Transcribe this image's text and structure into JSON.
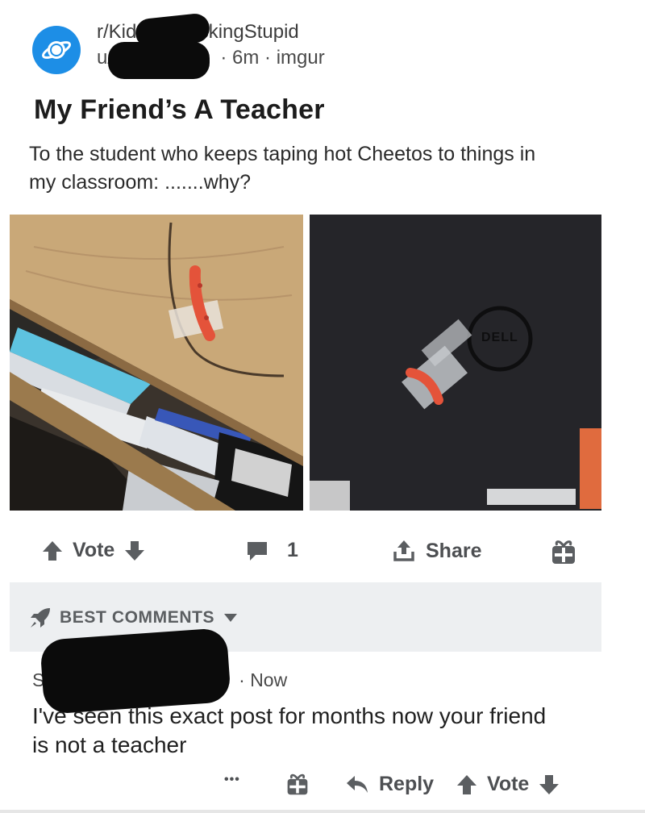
{
  "post": {
    "subreddit": "r/KidsAreFuckingStupid",
    "user_prefix": "u/",
    "age": "6m",
    "source": "imgur",
    "separator": "·",
    "title": "My Friend’s A Teacher",
    "body": "To the student who keeps taping hot Cheetos to things in my classroom: .......why?",
    "laptop_brand": "DELL"
  },
  "actions": {
    "vote_label": "Vote",
    "comment_count": "1",
    "share_label": "Share"
  },
  "comments_header": {
    "sort_label": "BEST COMMENTS"
  },
  "comment": {
    "author_initial": "S",
    "age": "Now",
    "text": "I've seen this exact post for months now your friend is not a teacher",
    "more_label": "•••",
    "reply_label": "Reply",
    "vote_label": "Vote"
  },
  "colors": {
    "subreddit_icon": "#1d8ee6",
    "best_band": "#edeff1",
    "icon_gray": "#5b5e61",
    "cheeto": "#e4533a"
  }
}
